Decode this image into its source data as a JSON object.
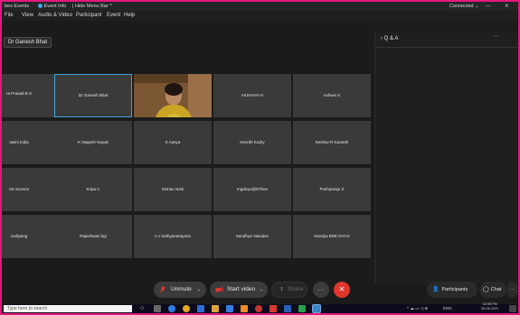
{
  "titlebar": {
    "app_left": "bex Events",
    "event_info": "Event Info",
    "hide_menu_bar": "Hide Menu Bar",
    "connected": "Connected"
  },
  "menu": [
    "File",
    "View",
    "Audio & Video",
    "Participant",
    "Event",
    "Help"
  ],
  "active_speaker": "Dr Ganesh Bhat",
  "tiles": [
    [
      "ra Prasad B S",
      "Dr Ganesh Bhat",
      "",
      "AKSHAYA H",
      "Ashwin K"
    ],
    [
      "awini India",
      "K Nagesh Nayak",
      "K Aasya",
      "Kenrith Kodry",
      "Keshav R Karanth"
    ],
    [
      "nis Scenes",
      "Kripa C",
      "Mohan Naik",
      "mgdivya@DTkev",
      "Pushparaju S"
    ],
    [
      "rushpang",
      "Rajeshwari bgi",
      "s v Sathyanarayana",
      "Sandhya Vasudev",
      "Sandya BRE DVCS"
    ]
  ],
  "tile_sub": "ns",
  "qa": {
    "title": "Q & A",
    "menu": "···"
  },
  "controls": {
    "unmute": "Unmute",
    "start_video": "Start video",
    "share": "Share",
    "more": "···",
    "participants": "Participants",
    "chat": "Chat",
    "more_right": "···"
  },
  "taskbar": {
    "search_placeholder": "Type here to search",
    "lang": "ENG",
    "time": "02:05 PM",
    "date": "25-06-2021"
  },
  "colors": {
    "accent": "#3ba5e0",
    "leave": "#e0362c",
    "border": "#e3187d"
  }
}
